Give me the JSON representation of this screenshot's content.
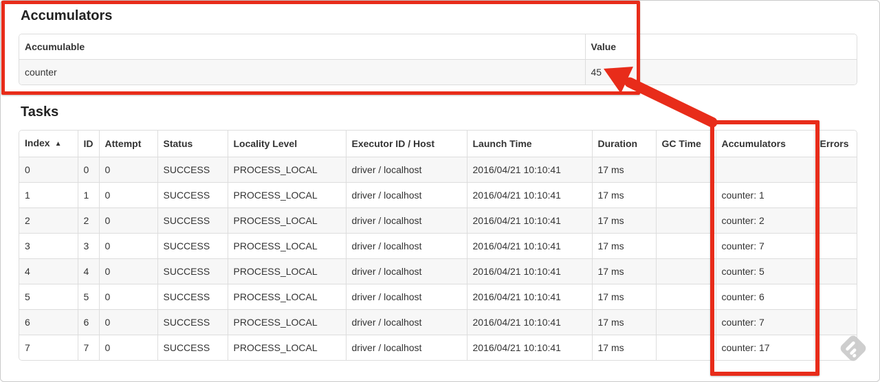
{
  "accumulators_section": {
    "title": "Accumulators",
    "table": {
      "columns": [
        "Accumulable",
        "Value"
      ],
      "rows": [
        [
          "counter",
          "45"
        ]
      ]
    }
  },
  "tasks_section": {
    "title": "Tasks",
    "table": {
      "columns": [
        "Index",
        "ID",
        "Attempt",
        "Status",
        "Locality Level",
        "Executor ID / Host",
        "Launch Time",
        "Duration",
        "GC Time",
        "Accumulators",
        "Errors"
      ],
      "sort": {
        "column": "Index",
        "icon": "▲"
      },
      "rows": [
        [
          "0",
          "0",
          "0",
          "SUCCESS",
          "PROCESS_LOCAL",
          "driver / localhost",
          "2016/04/21 10:10:41",
          "17 ms",
          "",
          "",
          ""
        ],
        [
          "1",
          "1",
          "0",
          "SUCCESS",
          "PROCESS_LOCAL",
          "driver / localhost",
          "2016/04/21 10:10:41",
          "17 ms",
          "",
          "counter: 1",
          ""
        ],
        [
          "2",
          "2",
          "0",
          "SUCCESS",
          "PROCESS_LOCAL",
          "driver / localhost",
          "2016/04/21 10:10:41",
          "17 ms",
          "",
          "counter: 2",
          ""
        ],
        [
          "3",
          "3",
          "0",
          "SUCCESS",
          "PROCESS_LOCAL",
          "driver / localhost",
          "2016/04/21 10:10:41",
          "17 ms",
          "",
          "counter: 7",
          ""
        ],
        [
          "4",
          "4",
          "0",
          "SUCCESS",
          "PROCESS_LOCAL",
          "driver / localhost",
          "2016/04/21 10:10:41",
          "17 ms",
          "",
          "counter: 5",
          ""
        ],
        [
          "5",
          "5",
          "0",
          "SUCCESS",
          "PROCESS_LOCAL",
          "driver / localhost",
          "2016/04/21 10:10:41",
          "17 ms",
          "",
          "counter: 6",
          ""
        ],
        [
          "6",
          "6",
          "0",
          "SUCCESS",
          "PROCESS_LOCAL",
          "driver / localhost",
          "2016/04/21 10:10:41",
          "17 ms",
          "",
          "counter: 7",
          ""
        ],
        [
          "7",
          "7",
          "0",
          "SUCCESS",
          "PROCESS_LOCAL",
          "driver / localhost",
          "2016/04/21 10:10:41",
          "17 ms",
          "",
          "counter: 17",
          ""
        ]
      ]
    }
  },
  "annotations": {
    "color": "#e82c1a"
  },
  "watermark": {
    "icon": "watermark-diamond-icon",
    "color": "#cccccc"
  }
}
